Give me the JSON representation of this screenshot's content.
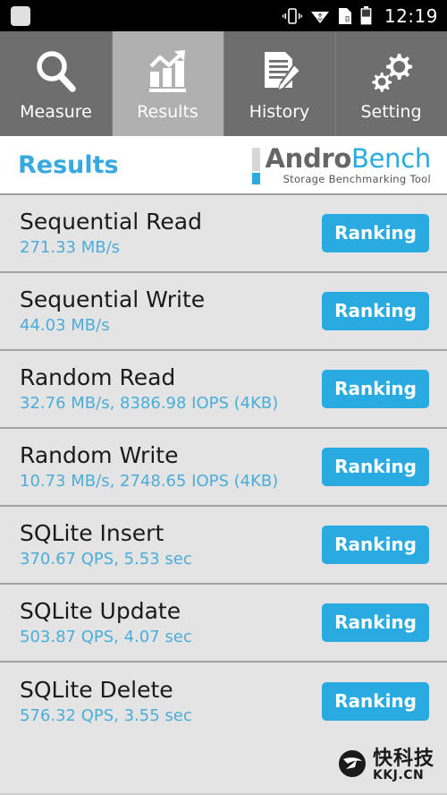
{
  "statusbar": {
    "time": "12:19",
    "icons": [
      "app-square",
      "vibrate-icon",
      "wifi-icon",
      "sim-card-icon",
      "battery-icon"
    ]
  },
  "tabs": [
    {
      "label": "Measure",
      "icon": "magnifier-icon",
      "selected": false
    },
    {
      "label": "Results",
      "icon": "bar-chart-arrow-icon",
      "selected": true
    },
    {
      "label": "History",
      "icon": "document-pencil-icon",
      "selected": false
    },
    {
      "label": "Setting",
      "icon": "gears-icon",
      "selected": false
    }
  ],
  "header": {
    "title": "Results",
    "logo_part1": "Andro",
    "logo_part2": "Bench",
    "logo_tagline": "Storage Benchmarking Tool"
  },
  "colors": {
    "accent_blue": "#29abe2",
    "value_blue": "#4badd9",
    "tab_bg": "#6e6e6e",
    "tab_selected_bg": "#b0b0b0",
    "row_bg": "#e4e4e4",
    "divider": "#a3a3a3"
  },
  "results": [
    {
      "name": "Sequential Read",
      "value": "271.33 MB/s",
      "button": "Ranking"
    },
    {
      "name": "Sequential Write",
      "value": "44.03 MB/s",
      "button": "Ranking"
    },
    {
      "name": "Random Read",
      "value": "32.76 MB/s, 8386.98 IOPS (4KB)",
      "button": "Ranking"
    },
    {
      "name": "Random Write",
      "value": "10.73 MB/s, 2748.65 IOPS (4KB)",
      "button": "Ranking"
    },
    {
      "name": "SQLite Insert",
      "value": "370.67 QPS, 5.53 sec",
      "button": "Ranking"
    },
    {
      "name": "SQLite Update",
      "value": "503.87 QPS, 4.07 sec",
      "button": "Ranking"
    },
    {
      "name": "SQLite Delete",
      "value": "576.32 QPS, 3.55 sec",
      "button": "Ranking"
    }
  ],
  "watermark": {
    "cn": "快科技",
    "en": "KKJ.CN",
    "icon": "arrow-circle-icon"
  }
}
